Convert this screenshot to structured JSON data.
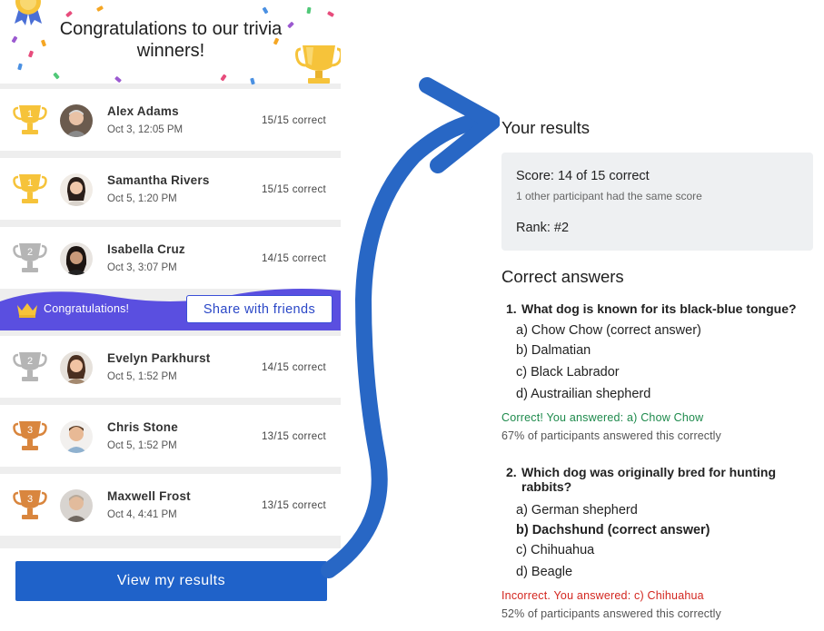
{
  "header": {
    "title": "Congratulations to our trivia winners!"
  },
  "winners": [
    {
      "name": "Alex Adams",
      "time": "Oct 3, 12:05 PM",
      "score": "15/15 correct",
      "place": "1",
      "trophy": "gold"
    },
    {
      "name": "Samantha Rivers",
      "time": "Oct 5, 1:20 PM",
      "score": "15/15 correct",
      "place": "1",
      "trophy": "gold"
    },
    {
      "name": "Isabella Cruz",
      "time": "Oct 3, 3:07 PM",
      "score": "14/15 correct",
      "place": "2",
      "trophy": "silver"
    },
    {
      "name": "Evelyn Parkhurst",
      "time": "Oct 5, 1:52 PM",
      "score": "14/15 correct",
      "place": "2",
      "trophy": "silver"
    },
    {
      "name": "Chris Stone",
      "time": "Oct 5, 1:52 PM",
      "score": "13/15 correct",
      "place": "3",
      "trophy": "bronze"
    },
    {
      "name": "Maxwell Frost",
      "time": "Oct 4, 4:41 PM",
      "score": "13/15 correct",
      "place": "3",
      "trophy": "bronze"
    }
  ],
  "banner": {
    "text": "Congratulations!",
    "share_label": "Share with friends",
    "icon": "crown-icon"
  },
  "footer": {
    "view_results_label": "View my results"
  },
  "results": {
    "heading": "Your results",
    "score_label": "Score:",
    "score_value": "14 of 15 correct",
    "score_note": "1 other participant had the same score",
    "rank_label": "Rank:",
    "rank_value": "#2"
  },
  "answers": {
    "heading": "Correct answers",
    "questions": [
      {
        "number": "1.",
        "text": "What dog is known for its black-blue tongue?",
        "options": [
          "a) Chow Chow (correct answer)",
          "b) Dalmatian",
          "c) Black Labrador",
          "d) Austrailian shepherd"
        ],
        "feedback": "Correct! You answered: a) Chow Chow",
        "percent": "67% of participants answered this correctly"
      },
      {
        "number": "2.",
        "text_line1": "Which dog was originally bred for hunting",
        "text_line2": "rabbits?",
        "options": [
          "a) German shepherd",
          "b) Dachshund (correct answer)",
          "c) Chihuahua",
          "d) Beagle"
        ],
        "feedback": "Incorrect. You answered: c) Chihuahua",
        "percent": "52% of participants answered this correctly"
      }
    ]
  },
  "colors": {
    "brand_blue": "#1f62c9",
    "banner_purple": "#5a4fe0",
    "correct_green": "#1e8a4c",
    "incorrect_red": "#d3261f",
    "gold": "#f6c33a",
    "silver": "#b5b5b5",
    "bronze": "#d9863e"
  }
}
